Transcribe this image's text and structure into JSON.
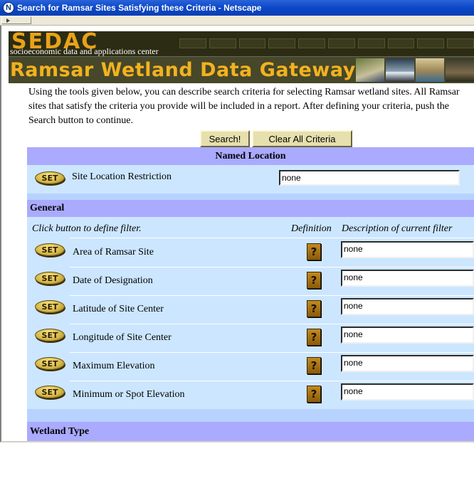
{
  "window": {
    "title": "Search for Ramsar Sites Satisfying these Criteria - Netscape",
    "app_icon": "netscape-icon"
  },
  "banner": {
    "logo": "SEDAC",
    "tagline": "socioeconomic data and applications center",
    "gateway_title": "Ramsar Wetland Data Gateway"
  },
  "intro": "Using the tools given below, you can describe search criteria for selecting Ramsar wetland sites. All Ramsar sites that satisfy the criteria you provide will be included in a report. After defining your criteria, push the Search button to continue.",
  "buttons": {
    "search": "Search!",
    "clear": "Clear All Criteria"
  },
  "named_location": {
    "heading": "Named Location",
    "set_label": "SET",
    "label": "Site Location Restriction",
    "value": "none"
  },
  "general": {
    "heading": "General",
    "instruction": "Click button to define filter.",
    "col_definition": "Definition",
    "col_description": "Description of current filter",
    "set_label": "SET",
    "help_label": "?",
    "rows": [
      {
        "label": "Area of Ramsar Site",
        "value": "none"
      },
      {
        "label": "Date of Designation",
        "value": "none"
      },
      {
        "label": "Latitude of Site Center",
        "value": "none"
      },
      {
        "label": "Longitude of Site Center",
        "value": "none"
      },
      {
        "label": "Maximum Elevation",
        "value": "none"
      },
      {
        "label": "Minimum or Spot Elevation",
        "value": "none"
      }
    ]
  },
  "wetland_type": {
    "heading": "Wetland Type"
  },
  "colors": {
    "header_band": "#aaaaff",
    "row_light": "#cce6ff",
    "row_mid": "#b8d2ff",
    "set_button": "#d7b84a",
    "help_button": "#a8741a"
  }
}
